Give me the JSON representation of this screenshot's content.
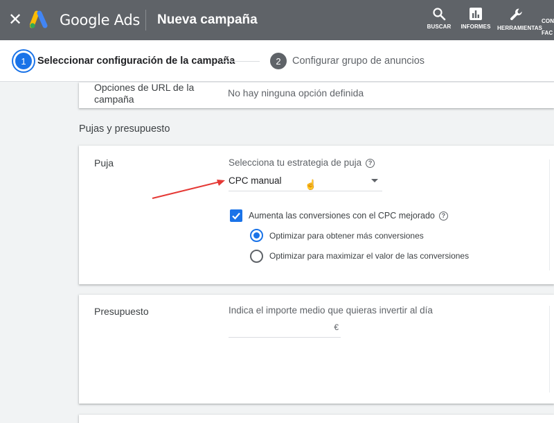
{
  "header": {
    "brand": "Google Ads",
    "title": "Nueva campaña",
    "tools": [
      {
        "label": "BUSCAR",
        "icon": "search-icon"
      },
      {
        "label": "INFORMES",
        "icon": "reports-icon"
      },
      {
        "label": "HERRAMIENTAS",
        "icon": "wrench-icon"
      },
      {
        "label": "CON",
        "icon": "billing-icon"
      }
    ],
    "tool_overflow_label": "FAC"
  },
  "stepper": {
    "steps": [
      {
        "number": "1",
        "label": "Seleccionar configuración de la campaña",
        "active": true
      },
      {
        "number": "2",
        "label": "Configurar grupo de anuncios",
        "active": false
      }
    ]
  },
  "url_options": {
    "label": "Opciones de URL de la campaña",
    "label_line1": "Opciones de URL de la",
    "label_line2": "campaña",
    "value": "No hay ninguna opción definida"
  },
  "section_heading": "Pujas y presupuesto",
  "bidding": {
    "label": "Puja",
    "prompt": "Selecciona tu estrategia de puja",
    "selected_strategy": "CPC manual",
    "enhanced_cpc": {
      "label": "Aumenta las conversiones con el CPC mejorado",
      "checked": true
    },
    "options": [
      {
        "label": "Optimizar para obtener más conversiones",
        "selected": true
      },
      {
        "label": "Optimizar para maximizar el valor de las conversiones",
        "selected": false
      }
    ]
  },
  "budget": {
    "label": "Presupuesto",
    "prompt": "Indica el importe medio que quieras invertir al día",
    "currency": "€",
    "value": ""
  },
  "colors": {
    "topbar": "#5f6368",
    "accent": "#1a73e8",
    "annotation_arrow": "#e53935"
  }
}
